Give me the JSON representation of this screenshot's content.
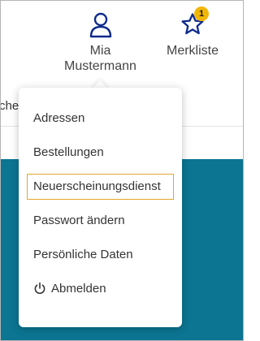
{
  "header": {
    "partial_text": "che",
    "user": {
      "first_name": "Mia",
      "last_name": "Mustermann",
      "icon": "user-icon"
    },
    "wishlist": {
      "label": "Merkliste",
      "badge_count": "1",
      "icon": "star-icon"
    }
  },
  "menu": {
    "items": [
      {
        "label": "Adressen"
      },
      {
        "label": "Bestellungen"
      },
      {
        "label": "Neuerscheinungsdienst",
        "focused": true
      },
      {
        "label": "Passwort ändern"
      },
      {
        "label": "Persönliche Daten"
      },
      {
        "label": "Abmelden",
        "icon": "power-icon"
      }
    ]
  },
  "colors": {
    "brand_blue": "#0e2a8c",
    "teal": "#0b7592",
    "badge": "#f2b705",
    "focus_outline": "#e0a82e"
  }
}
